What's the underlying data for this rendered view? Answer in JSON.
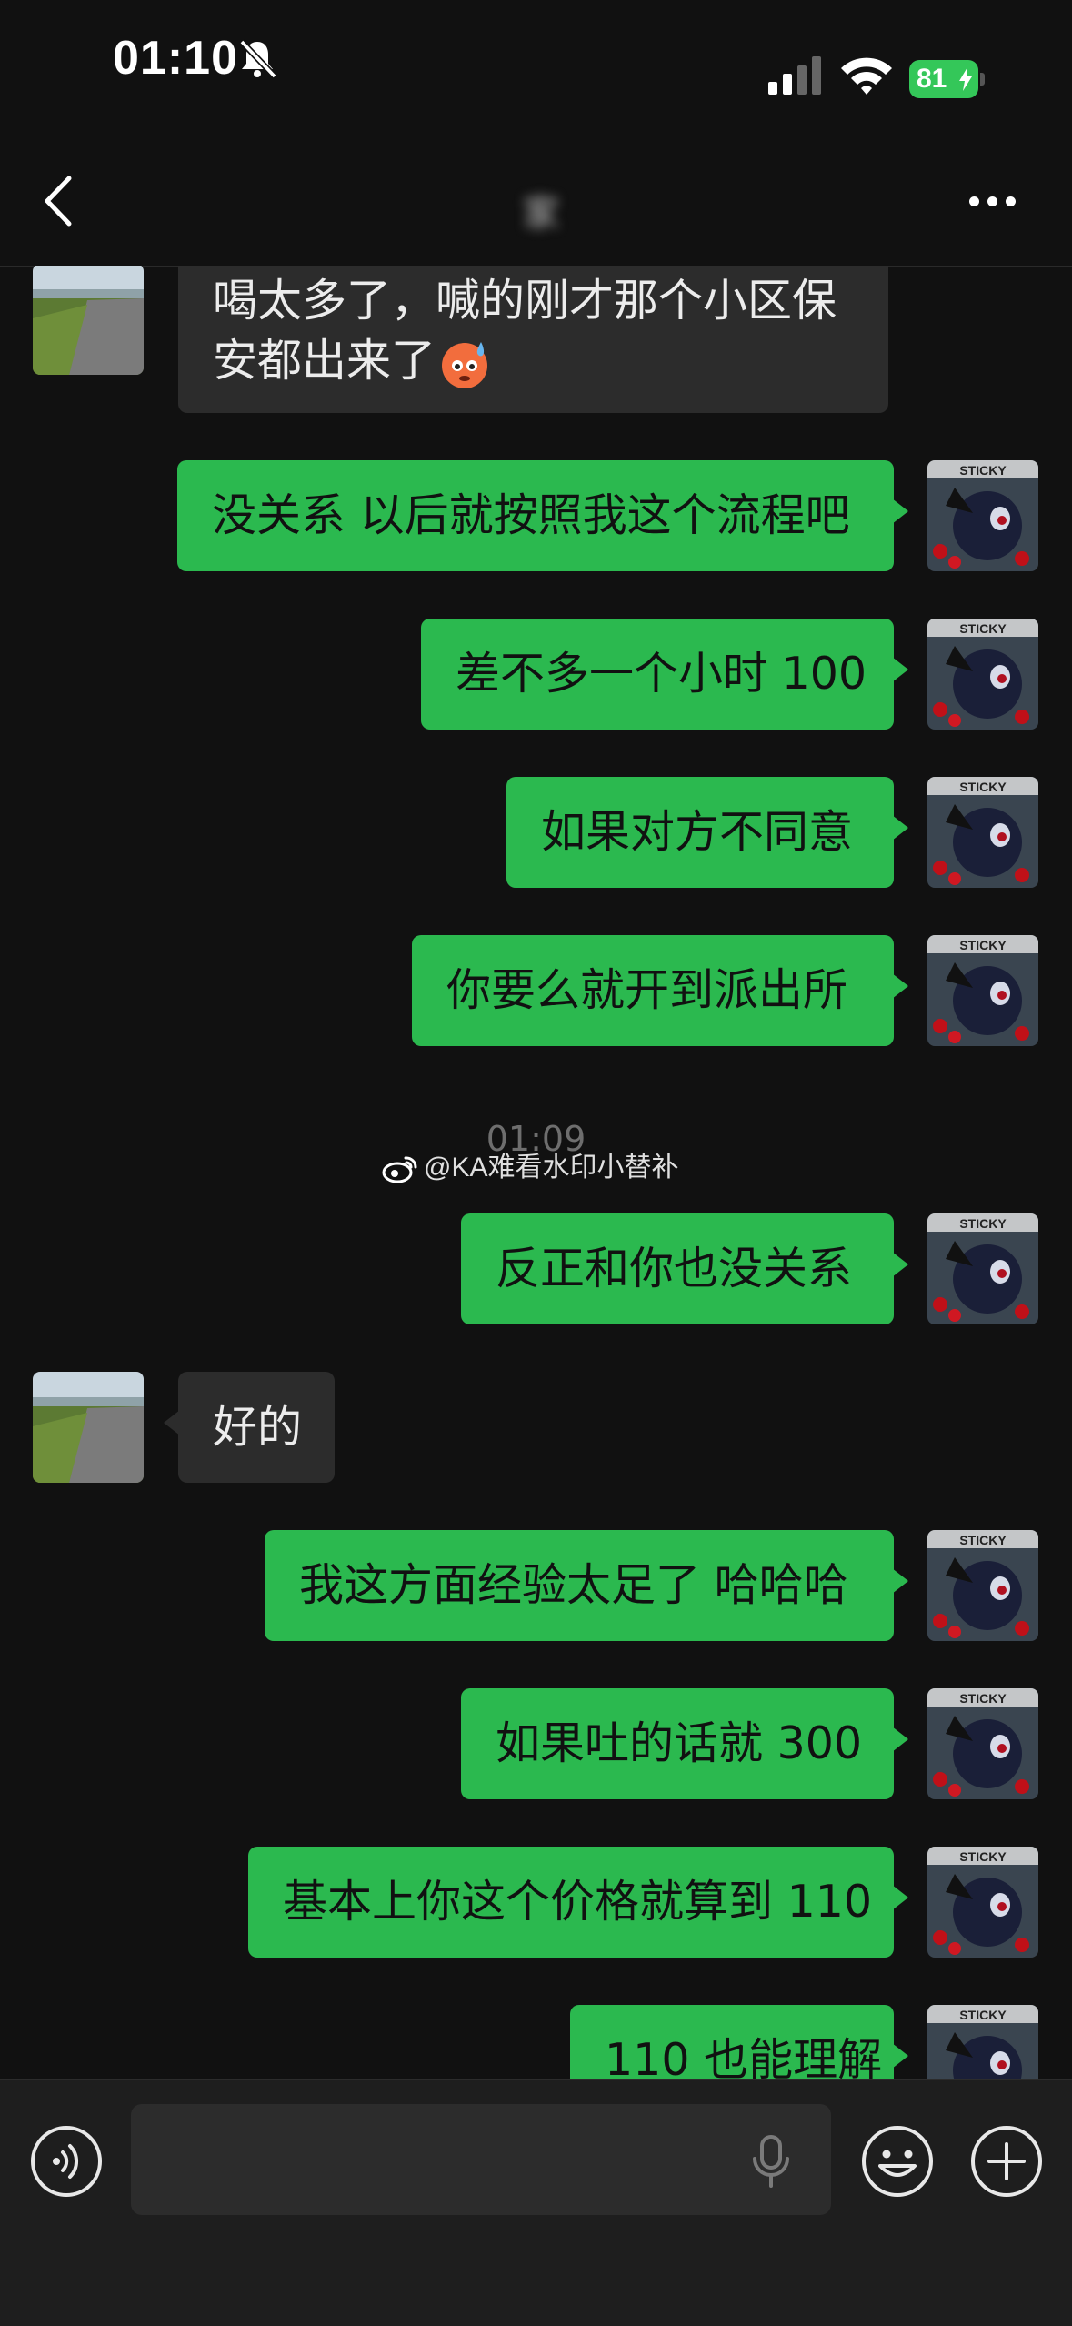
{
  "status_bar": {
    "time": "01:10",
    "battery": "81"
  },
  "nav": {
    "title": "家"
  },
  "messages": [
    {
      "side": "peer",
      "text_line1": "喝太多了，喊的刚才那个小区保",
      "text_line2": "安都出来了",
      "emoji": "anxious-sweat-face-emoji"
    },
    {
      "side": "self",
      "text": "没关系 以后就按照我这个流程吧"
    },
    {
      "side": "self",
      "text": "差不多一个小时 100"
    },
    {
      "side": "self",
      "text": "如果对方不同意"
    },
    {
      "side": "self",
      "text": "你要么就开到派出所"
    },
    {
      "side": "self",
      "text": "反正和你也没关系"
    },
    {
      "side": "peer",
      "text": "好的"
    },
    {
      "side": "self",
      "text": "我这方面经验太足了 哈哈哈"
    },
    {
      "side": "self",
      "text": "如果吐的话就 300"
    },
    {
      "side": "self",
      "text": "基本上你这个价格就算到 110"
    },
    {
      "side": "self",
      "text": "110 也能理解"
    }
  ],
  "time_separator": "01:09",
  "watermark": "@KA难看水印小替补",
  "input": {
    "placeholder": ""
  },
  "colors": {
    "self_bubble": "#2bb94f",
    "peer_bubble": "#2c2c2c",
    "background": "#111111",
    "battery": "#34c759"
  }
}
